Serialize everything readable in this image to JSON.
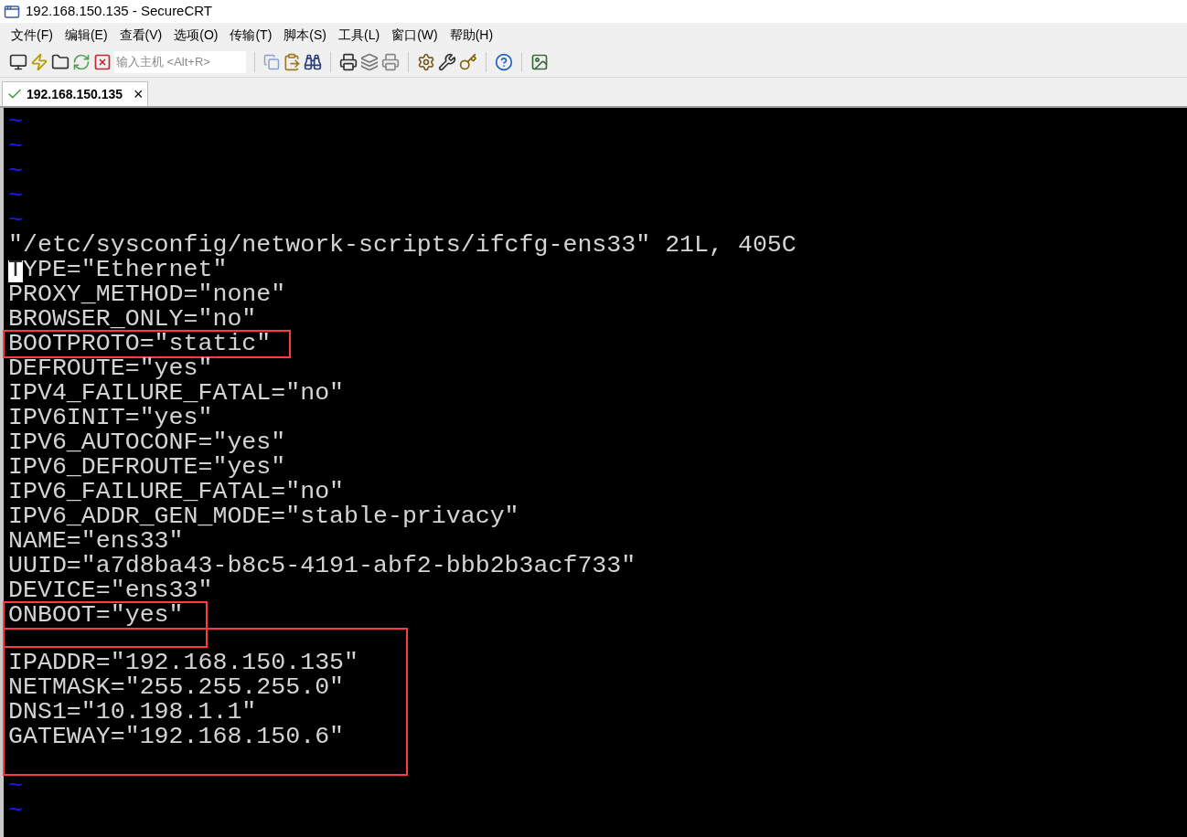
{
  "window": {
    "title": "192.168.150.135 - SecureCRT"
  },
  "menu": [
    "文件(F)",
    "编辑(E)",
    "查看(V)",
    "选项(O)",
    "传输(T)",
    "脚本(S)",
    "工具(L)",
    "窗口(W)",
    "帮助(H)"
  ],
  "toolbar": {
    "host_field": {
      "placeholder": "输入主机 <Alt+R>"
    }
  },
  "tabs": [
    {
      "label": "192.168.150.135",
      "selected": true,
      "connected": true,
      "close": "×"
    }
  ],
  "terminal": {
    "blocks": [
      {
        "kind": "line",
        "text": "~",
        "tilde": true
      },
      {
        "kind": "line",
        "text": "~",
        "tilde": true
      },
      {
        "kind": "line",
        "text": "~",
        "tilde": true
      },
      {
        "kind": "line",
        "text": "~",
        "tilde": true
      },
      {
        "kind": "line",
        "text": "~",
        "tilde": true
      },
      {
        "kind": "line",
        "text": "\"/etc/sysconfig/network-scripts/ifcfg-ens33\" 21L, 405C",
        "tilde": false
      },
      {
        "kind": "line",
        "text": "TYPE=\"Ethernet\"",
        "tilde": false,
        "cursor": true
      },
      {
        "kind": "line",
        "text": "PROXY_METHOD=\"none\"",
        "tilde": false
      },
      {
        "kind": "line",
        "text": "BROWSER_ONLY=\"no\"",
        "tilde": false
      },
      {
        "kind": "box",
        "lines": [
          "BOOTPROTO=\"static\""
        ]
      },
      {
        "kind": "line",
        "text": "DEFROUTE=\"yes\"",
        "tilde": false
      },
      {
        "kind": "line",
        "text": "IPV4_FAILURE_FATAL=\"no\"",
        "tilde": false
      },
      {
        "kind": "line",
        "text": "IPV6INIT=\"yes\"",
        "tilde": false
      },
      {
        "kind": "line",
        "text": "IPV6_AUTOCONF=\"yes\"",
        "tilde": false
      },
      {
        "kind": "line",
        "text": "IPV6_DEFROUTE=\"yes\"",
        "tilde": false
      },
      {
        "kind": "line",
        "text": "IPV6_FAILURE_FATAL=\"no\"",
        "tilde": false
      },
      {
        "kind": "line",
        "text": "IPV6_ADDR_GEN_MODE=\"stable-privacy\"",
        "tilde": false
      },
      {
        "kind": "line",
        "text": "NAME=\"ens33\"",
        "tilde": false
      },
      {
        "kind": "line",
        "text": "UUID=\"a7d8ba43-b8c5-4191-abf2-bbb2b3acf733\"",
        "tilde": false
      },
      {
        "kind": "line",
        "text": "DEVICE=\"ens33\"",
        "tilde": false
      },
      {
        "kind": "box",
        "lines": [
          "ONBOOT=\"yes\""
        ]
      },
      {
        "kind": "box",
        "lines": [
          "IPADDR=\"192.168.150.135\"",
          "NETMASK=\"255.255.255.0\"",
          "DNS1=\"10.198.1.1\"",
          "GATEWAY=\"192.168.150.6\""
        ]
      },
      {
        "kind": "line",
        "text": "~",
        "tilde": true
      },
      {
        "kind": "line",
        "text": "~",
        "tilde": true
      }
    ]
  }
}
